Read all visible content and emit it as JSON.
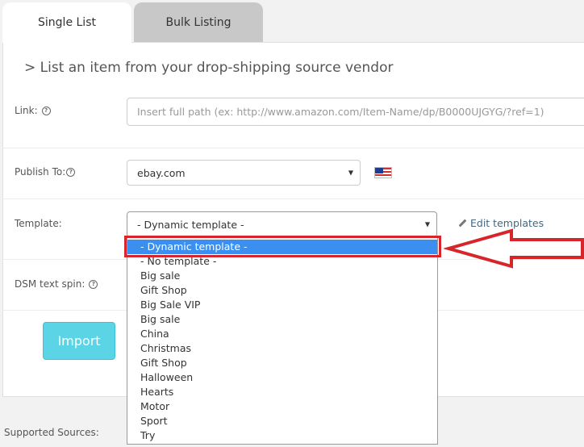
{
  "tabs": [
    {
      "label": "Single List",
      "active": true
    },
    {
      "label": "Bulk Listing",
      "active": false
    }
  ],
  "heading": "> List an item from your drop-shipping source vendor",
  "link": {
    "label": "Link:",
    "placeholder": "Insert full path (ex: http://www.amazon.com/Item-Name/dp/B0000UJGYG/?ref=1)"
  },
  "publish": {
    "label": "Publish To:",
    "value": "ebay.com"
  },
  "template": {
    "label": "Template:",
    "value": "- Dynamic template -",
    "edit_label": "Edit templates",
    "options": [
      "- Dynamic template -",
      "- No template -",
      "Big sale",
      "Gift Shop",
      "Big Sale VIP",
      "Big sale",
      "China",
      "Christmas",
      "Gift Shop",
      "Halloween",
      "Hearts",
      "Motor",
      "Sport",
      "Try"
    ],
    "selected_index": 0
  },
  "dsm": {
    "label": "DSM text spin:"
  },
  "import_label": "Import",
  "supported_sources_label": "Supported Sources:",
  "help_glyph": "?",
  "caret_glyph": "▼",
  "icons": {
    "help": "question-circle-icon",
    "flag": "us-flag-icon",
    "edit": "pencil-icon",
    "caret": "caret-down-icon",
    "annotation": "red-arrow-icon"
  },
  "colors": {
    "accent": "#5bd4e6",
    "selection": "#3b8ff0",
    "annotation": "#d6262b",
    "inactive_tab": "#c8c8c8"
  }
}
